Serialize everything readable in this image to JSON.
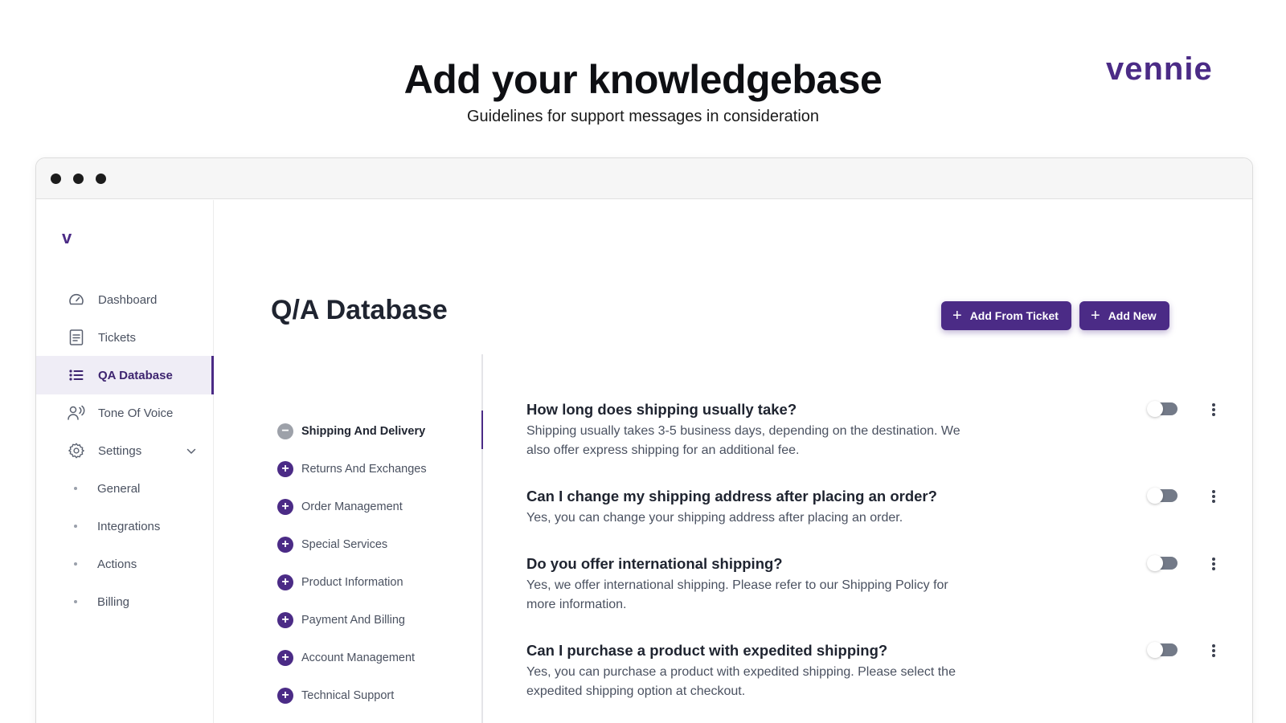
{
  "hero": {
    "title": "Add your knowledgebase",
    "subtitle": "Guidelines for support messages in consideration",
    "brand": "vennie"
  },
  "sidebar": {
    "logo": "v",
    "items": [
      {
        "label": "Dashboard",
        "icon": "gauge-icon"
      },
      {
        "label": "Tickets",
        "icon": "document-icon"
      },
      {
        "label": "QA Database",
        "icon": "list-icon",
        "active": true
      },
      {
        "label": "Tone Of Voice",
        "icon": "voice-icon"
      },
      {
        "label": "Settings",
        "icon": "gear-icon"
      }
    ],
    "settings_sub": [
      "General",
      "Integrations",
      "Actions",
      "Billing"
    ]
  },
  "main": {
    "title": "Q/A Database",
    "add_from_ticket_label": "Add From Ticket",
    "add_new_label": "Add New",
    "categories": [
      {
        "label": "Shipping And Delivery",
        "expanded": true
      },
      {
        "label": "Returns And Exchanges"
      },
      {
        "label": "Order Management"
      },
      {
        "label": "Special Services"
      },
      {
        "label": "Product Information"
      },
      {
        "label": "Payment And Billing"
      },
      {
        "label": "Account Management"
      },
      {
        "label": "Technical Support"
      }
    ],
    "qa": [
      {
        "q": "How long does shipping usually take?",
        "a": "Shipping usually takes 3-5 business days, depending on the destination. We also offer express shipping for an additional fee."
      },
      {
        "q": "Can I change my shipping address after placing an order?",
        "a": "Yes, you can change your shipping address after placing an order."
      },
      {
        "q": "Do you offer international shipping?",
        "a": "Yes, we offer international shipping. Please refer to our Shipping Policy for more information."
      },
      {
        "q": "Can I purchase a product with expedited shipping?",
        "a": "Yes, you can purchase a product with expedited shipping. Please select the expedited shipping option at checkout."
      }
    ]
  },
  "colors": {
    "brand": "#4b2b86",
    "active_bg": "#efedf6",
    "text": "#1f2430",
    "muted": "#4a5160"
  }
}
